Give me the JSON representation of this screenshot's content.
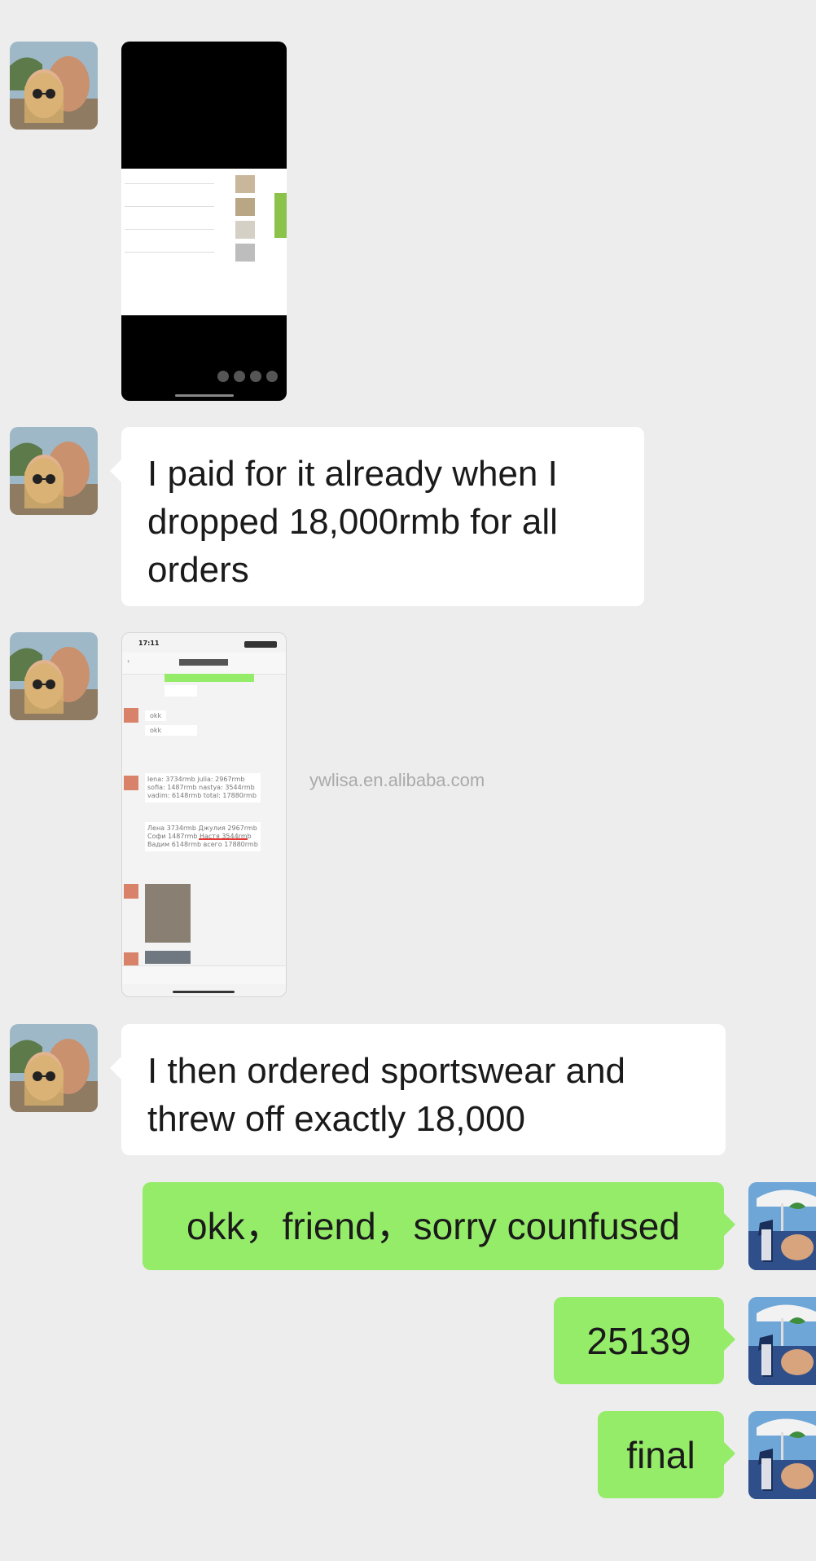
{
  "messages": {
    "m2": {
      "text": "I paid for it already when I dropped 18,000rmb for all orders"
    },
    "m4": {
      "text": "I then ordered sportswear and threw off exactly 18,000"
    },
    "m5": {
      "text": "okk，friend，sorry counfused"
    },
    "m6": {
      "text": "25139"
    },
    "m7": {
      "text": "final"
    }
  },
  "screenshot_thumb": {
    "status_time": "17:11",
    "reply_okk_1": "okk",
    "reply_okk_2": "okk",
    "text_block_1": "lena: 3734rmb  julia: 2967rmb  sofia: 1487rmb  nastya: 3544rmb  vadim: 6148rmb  total: 17880rmb",
    "text_block_2": "Лена 3734rmb Джулия 2967rmb Софи 1487rmb Настя 3544rmb Вадим 6148rmb всего 17880rmb"
  },
  "watermark": "ywlisa.en.alibaba.com",
  "colors": {
    "background": "#ededed",
    "incoming_bubble": "#ffffff",
    "outgoing_bubble": "#95ec69"
  }
}
